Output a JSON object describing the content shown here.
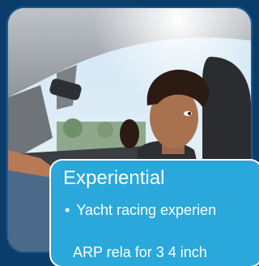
{
  "slide": {
    "heading": "Experiential",
    "bullets": [
      "Yacht racing experien"
    ],
    "secondary_line": "ARP rela for 3 4 inch",
    "bullet_symbol": "•"
  },
  "colors": {
    "background": "#0b3d6b",
    "panel": "#2aa8db",
    "panel_border": "#ffffff",
    "text": "#ffffff"
  },
  "photo": {
    "description_icon": "car-interior-photo-icon"
  }
}
